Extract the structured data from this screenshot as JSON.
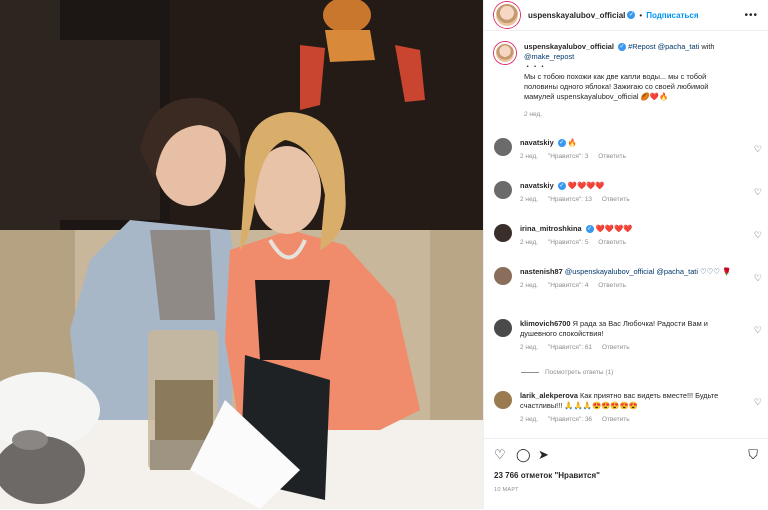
{
  "header": {
    "username": "uspenskayalubov_official",
    "follow_label": "Подписаться",
    "more": "•••"
  },
  "caption": {
    "username": "uspenskayalubov_official",
    "repost_tag": "#Repost",
    "repost_user": "@pacha_tati",
    "with_text": "with",
    "make_repost": "@make_repost",
    "dots": "・・・",
    "body": "Мы с тобою похожи как две капли воды... мы с тобой половины одного яблока! Зажигаю со своей любимой мамулей uspenskayalubov_official 🏉❤️🔥",
    "time": "2 нед."
  },
  "comments": [
    {
      "user": "navatskiy",
      "text": "🔥",
      "time": "2 нед.",
      "likes": "\"Нравится\": 3",
      "reply": "Ответить",
      "color": "#6b6b6b"
    },
    {
      "user": "navatskiy",
      "text": "❤️❤️❤️❤️",
      "time": "2 нед.",
      "likes": "\"Нравится\": 13",
      "reply": "Ответить",
      "color": "#6b6b6b"
    },
    {
      "user": "irina_mitroshkina",
      "text": "❤️❤️❤️❤️",
      "time": "2 нед.",
      "likes": "\"Нравится\": 5",
      "reply": "Ответить",
      "color": "#3a2e2a"
    },
    {
      "user": "nastenish87",
      "text": "@uspenskayalubov_official @pacha_tati ♡♡♡ 🌹",
      "time": "2 нед.",
      "likes": "\"Нравится\": 4",
      "reply": "Ответить",
      "color": "#8a6d5a"
    },
    {
      "user": "klimovich6700",
      "text": "Я рада за Вас Любочка! Радости Вам и душевного спокойствия!",
      "time": "2 нед.",
      "likes": "\"Нравится\": 61",
      "reply": "Ответить",
      "color": "#4a4a4a"
    },
    {
      "user": "larik_alekperova",
      "text": "Как приятно вас видеть вместе!!! Будьте счастливы!!! 🙏🙏🙏😍😍😍😍😍",
      "time": "2 нед.",
      "likes": "\"Нравится\": 36",
      "reply": "Ответить",
      "color": "#9a7b4f"
    }
  ],
  "view_replies": "Посмотреть ответы (1)",
  "actions": {
    "like_icon": "heart-icon",
    "comment_icon": "comment-icon",
    "share_icon": "share-icon",
    "save_icon": "bookmark-icon",
    "likes_text": "23 766 отметок \"Нравится\"",
    "date": "10 МАРТ"
  },
  "colors": {
    "accent": "#0095f6",
    "verified": "#3897f0",
    "muted": "#8e8e8e"
  }
}
